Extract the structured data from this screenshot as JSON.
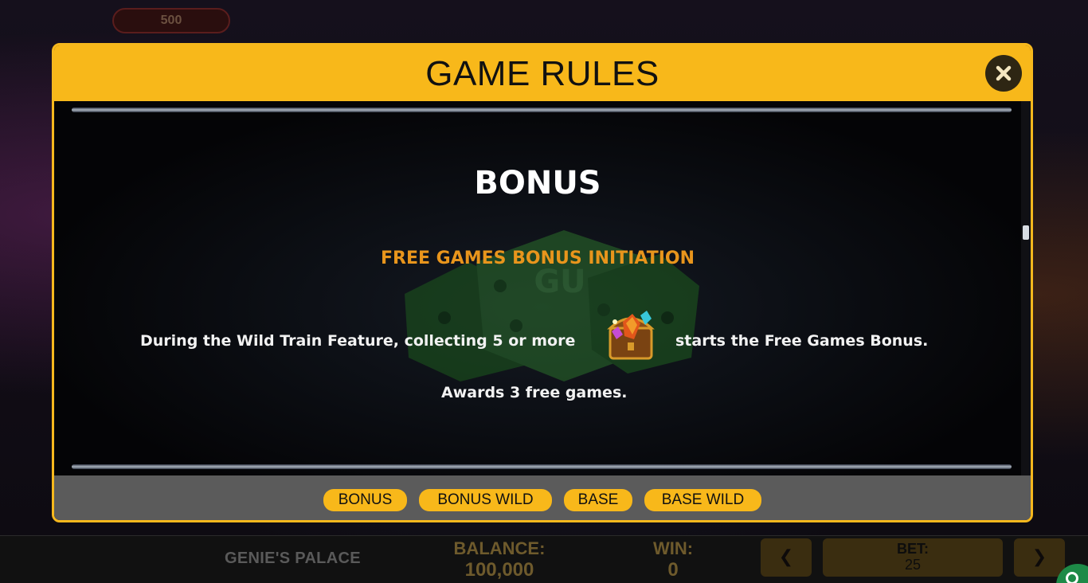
{
  "background": {
    "top_pill_value": "500"
  },
  "modal": {
    "title": "GAME RULES",
    "close_icon": "close-icon",
    "section_heading": "BONUS",
    "subheading": "FREE GAMES BONUS INITIATION",
    "rule_line_1_before": "During the Wild Train Feature, collecting 5 or more",
    "rule_line_1_symbol": "jewel-chest-icon",
    "rule_line_1_after": "starts the Free Games Bonus.",
    "rule_line_2": "Awards 3 free games.",
    "tabs": [
      {
        "label": "BONUS"
      },
      {
        "label": "BONUS WILD"
      },
      {
        "label": "BASE"
      },
      {
        "label": "BASE WILD"
      }
    ]
  },
  "status_bar": {
    "game_name": "GENIE'S PALACE",
    "balance_label": "BALANCE:",
    "balance_value": "100,000",
    "win_label": "WIN:",
    "win_value": "0",
    "bet_decrease_label": "❮",
    "bet_label": "BET:",
    "bet_value": "25",
    "bet_increase_label": "❯"
  },
  "colors": {
    "accent": "#f8b81a",
    "subheading": "#e8951c",
    "status_text": "#6e5a2c",
    "tab_bar": "#5b5b5b"
  }
}
